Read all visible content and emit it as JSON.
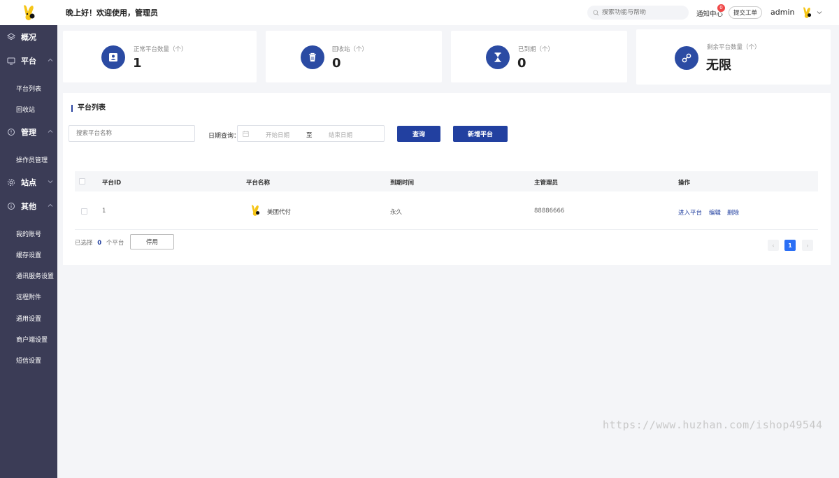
{
  "sidebar": {
    "groups": [
      {
        "label": "概况",
        "icon": "layers-icon"
      },
      {
        "label": "平台",
        "icon": "monitor-icon",
        "items": [
          "平台列表",
          "回收站"
        ]
      },
      {
        "label": "管理",
        "icon": "shield-icon",
        "items": [
          "操作员管理"
        ]
      },
      {
        "label": "站点",
        "icon": "gear-icon"
      },
      {
        "label": "其他",
        "icon": "info-icon",
        "items": [
          "我的账号",
          "缓存设置",
          "通讯服务设置",
          "远程附件",
          "通用设置",
          "商户端设置",
          "短信设置"
        ]
      }
    ]
  },
  "header": {
    "greeting": "晚上好！欢迎使用，管理员",
    "search_placeholder": "搜索功能与帮助",
    "notify_label": "通知中心",
    "notify_count": "0",
    "ticket_label": "提交工单",
    "username": "admin"
  },
  "stats": [
    {
      "label": "正常平台数量（个）",
      "value": "1",
      "icon": "id-card-icon"
    },
    {
      "label": "回收站（个）",
      "value": "0",
      "icon": "trash-icon"
    },
    {
      "label": "已到期（个）",
      "value": "0",
      "icon": "hourglass-icon"
    },
    {
      "label": "剩余平台数量（个）",
      "value": "无限",
      "icon": "link-icon"
    }
  ],
  "panel": {
    "title": "平台列表",
    "name_placeholder": "搜索平台名称",
    "date_label": "日期查询：",
    "date_start_placeholder": "开始日期",
    "date_sep": "至",
    "date_end_placeholder": "结束日期",
    "query_label": "查询",
    "add_label": "新增平台"
  },
  "table": {
    "columns": [
      "平台ID",
      "平台名称",
      "到期时间",
      "主管理员",
      "操作"
    ],
    "rows": [
      {
        "id": "1",
        "name": "美团代付",
        "expire": "永久",
        "admin": "88886666",
        "actions": [
          "进入平台",
          "编辑",
          "删除"
        ]
      }
    ]
  },
  "footer": {
    "selected_prefix": "已选择",
    "selected_count": "0",
    "selected_suffix": "个平台",
    "disable_label": "停用",
    "current_page": "1",
    "prev": "‹",
    "next": "›"
  },
  "watermark": "https://www.huzhan.com/ishop49544",
  "colors": {
    "sidebar": "#3b3c56",
    "primary": "#2240a0",
    "page_active": "#2b6ff5",
    "badge": "#f04848"
  }
}
